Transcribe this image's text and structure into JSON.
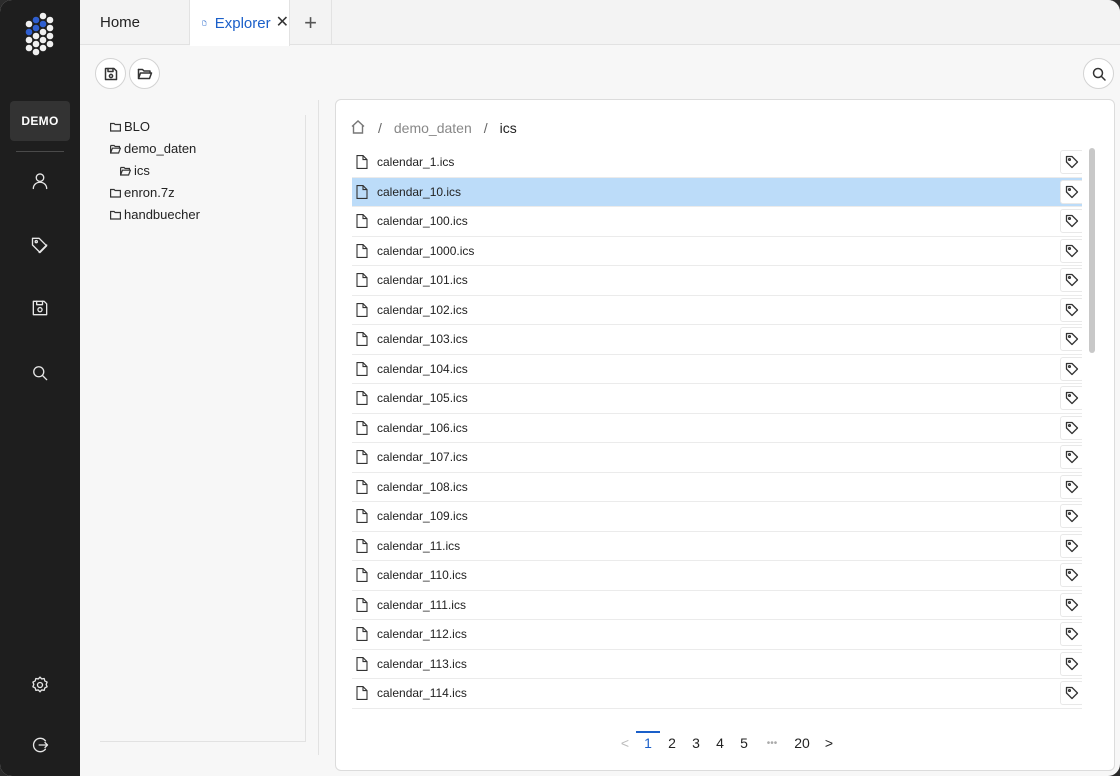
{
  "tabs": {
    "home_label": "Home",
    "explorer_label": "Explorer",
    "add_label": "+"
  },
  "sidebar": {
    "badge": "DEMO",
    "items": [
      "user-icon",
      "tag-icon",
      "save-icon",
      "search-icon"
    ],
    "bottom": [
      "settings-icon",
      "logout-icon"
    ]
  },
  "toolbar": {
    "buttons": [
      "save-icon",
      "folder-open-icon",
      "search-icon"
    ]
  },
  "tree": {
    "items": [
      {
        "label": "BLO",
        "depth": 0,
        "open": false
      },
      {
        "label": "demo_daten",
        "depth": 0,
        "open": true
      },
      {
        "label": "ics",
        "depth": 1,
        "open": true
      },
      {
        "label": "enron.7z",
        "depth": 0,
        "open": false
      },
      {
        "label": "handbuecher",
        "depth": 0,
        "open": false
      }
    ]
  },
  "breadcrumb": {
    "parts": [
      "demo_daten",
      "ics"
    ],
    "separator": "/"
  },
  "files": [
    "calendar_1.ics",
    "calendar_10.ics",
    "calendar_100.ics",
    "calendar_1000.ics",
    "calendar_101.ics",
    "calendar_102.ics",
    "calendar_103.ics",
    "calendar_104.ics",
    "calendar_105.ics",
    "calendar_106.ics",
    "calendar_107.ics",
    "calendar_108.ics",
    "calendar_109.ics",
    "calendar_11.ics",
    "calendar_110.ics",
    "calendar_111.ics",
    "calendar_112.ics",
    "calendar_113.ics",
    "calendar_114.ics"
  ],
  "selected_index": 1,
  "pagination": {
    "prev": "<",
    "pages": [
      "1",
      "2",
      "3",
      "4",
      "5"
    ],
    "ellipsis": "•••",
    "last": "20",
    "next": ">",
    "active": "1"
  },
  "colors": {
    "accent": "#1a5fc9",
    "selected_row": "#bcdcf9",
    "sidebar_bg": "#1e1e1e"
  }
}
